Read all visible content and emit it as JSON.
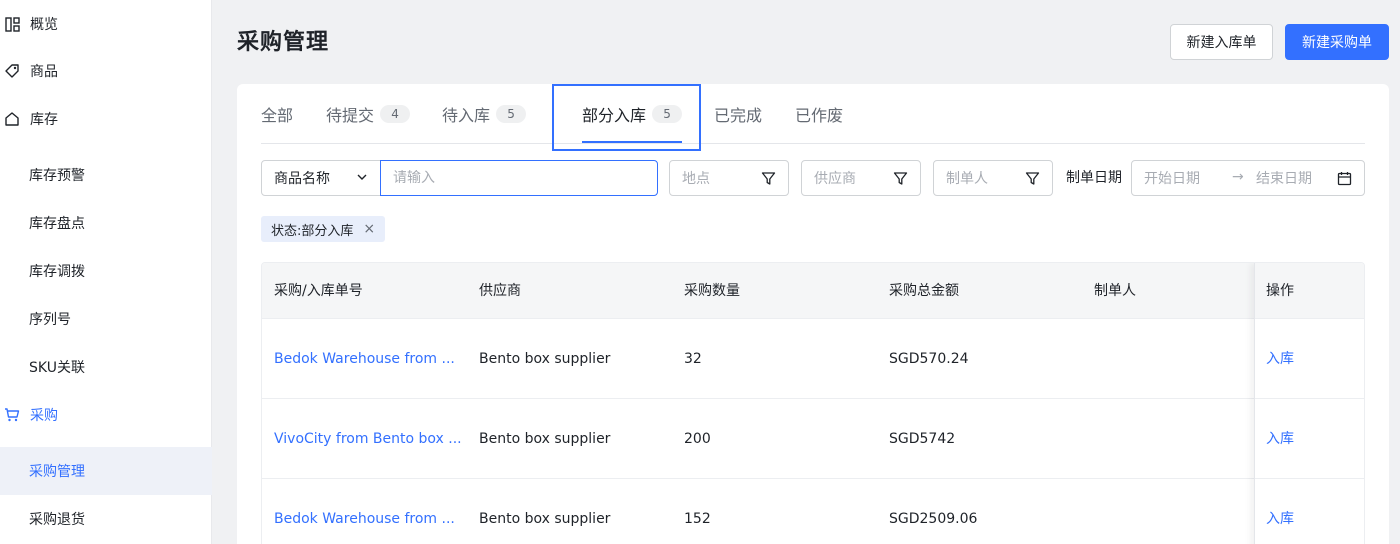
{
  "sidebar": {
    "items": [
      {
        "label": "概览",
        "icon": "dashboard-icon"
      },
      {
        "label": "商品",
        "icon": "tag-icon"
      },
      {
        "label": "库存",
        "icon": "warehouse-icon"
      },
      {
        "label": "库存预警"
      },
      {
        "label": "库存盘点"
      },
      {
        "label": "库存调拨"
      },
      {
        "label": "序列号"
      },
      {
        "label": "SKU关联"
      },
      {
        "label": "采购",
        "icon": "cart-icon"
      },
      {
        "label": "采购管理"
      },
      {
        "label": "采购退货"
      }
    ]
  },
  "header": {
    "title": "采购管理",
    "btn_new_inbound": "新建入库单",
    "btn_new_purchase": "新建采购单"
  },
  "tabs": [
    {
      "label": "全部"
    },
    {
      "label": "待提交",
      "count": "4"
    },
    {
      "label": "待入库",
      "count": "5"
    },
    {
      "label": "部分入库",
      "count": "5"
    },
    {
      "label": "已完成"
    },
    {
      "label": "已作废"
    }
  ],
  "filters": {
    "field_select": "商品名称",
    "search_placeholder": "请输入",
    "location_placeholder": "地点",
    "supplier_placeholder": "供应商",
    "maker_placeholder": "制单人",
    "date_label": "制单日期",
    "start_placeholder": "开始日期",
    "end_placeholder": "结束日期",
    "arrow": "→"
  },
  "active_tag": "状态:部分入库",
  "table": {
    "columns": [
      "采购/入库单号",
      "供应商",
      "采购数量",
      "采购总金额",
      "制单人",
      "操作"
    ],
    "rows": [
      {
        "order": "Bedok Warehouse from ...",
        "supplier": "Bento box supplier",
        "qty": "32",
        "amount": "SGD570.24",
        "maker": "",
        "action": "入库"
      },
      {
        "order": "VivoCity from Bento box ...",
        "supplier": "Bento box supplier",
        "qty": "200",
        "amount": "SGD5742",
        "maker": "",
        "action": "入库"
      },
      {
        "order": "Bedok Warehouse from ...",
        "supplier": "Bento box supplier",
        "qty": "152",
        "amount": "SGD2509.06",
        "maker": "",
        "action": "入库"
      }
    ]
  },
  "colors": {
    "accent": "#3370ff",
    "tag_bg": "#e8eefb"
  }
}
